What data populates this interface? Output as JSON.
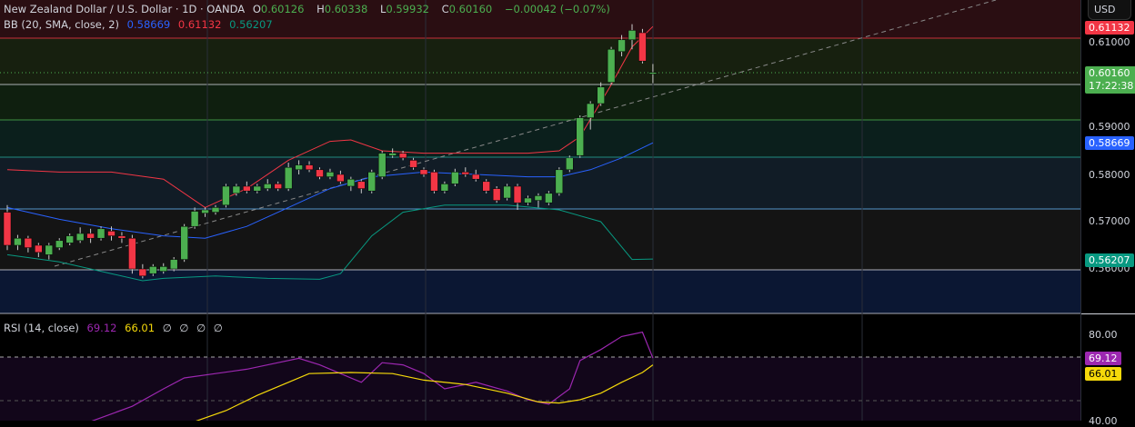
{
  "header": {
    "symbol": "New Zealand Dollar / U.S. Dollar · 1D · OANDA",
    "o_label": "O",
    "o": "0.60126",
    "h_label": "H",
    "h": "0.60338",
    "l_label": "L",
    "l": "0.59932",
    "c_label": "C",
    "c": "0.60160",
    "change": "−0.00042 (−0.07%)"
  },
  "bb": {
    "label": "BB (20, SMA, close, 2)",
    "basis": "0.58669",
    "upper": "0.61132",
    "lower": "0.56207"
  },
  "rsi": {
    "label": "RSI (14, close)",
    "value": "69.12",
    "ma": "66.01",
    "extras": [
      "∅",
      "∅",
      "∅",
      "∅"
    ]
  },
  "axis": {
    "currency": "USD",
    "ticks": [
      "0.59000",
      "0.58000",
      "0.57000"
    ],
    "hidden_ticks": [
      "0.61000",
      "0.56000"
    ],
    "price_tag": "0.60160",
    "countdown": "17:22:38",
    "upper_tag": "0.61132",
    "basis_tag": "0.58669",
    "lower_tag": "0.56207",
    "rsi_ticks": [
      "80.00",
      "40.00"
    ],
    "rsi_tag": "69.12",
    "rsi_ma_tag": "66.01"
  },
  "colors": {
    "up": "#4caf50",
    "down": "#f23645",
    "upper": "#f23645",
    "basis": "#2962ff",
    "lower": "#089981",
    "rsi": "#9c27b0",
    "rsi_ma": "#f5d90a"
  },
  "chart_data": {
    "type": "candlestick",
    "candles": [
      [
        0.572,
        0.5735,
        0.564,
        0.565
      ],
      [
        0.565,
        0.5672,
        0.564,
        0.5665
      ],
      [
        0.5665,
        0.567,
        0.5635,
        0.5645
      ],
      [
        0.565,
        0.5655,
        0.5625,
        0.5635
      ],
      [
        0.563,
        0.5655,
        0.562,
        0.565
      ],
      [
        0.5645,
        0.5665,
        0.564,
        0.566
      ],
      [
        0.5655,
        0.5675,
        0.565,
        0.567
      ],
      [
        0.566,
        0.5688,
        0.5655,
        0.5675
      ],
      [
        0.5675,
        0.5685,
        0.5655,
        0.5665
      ],
      [
        0.5665,
        0.569,
        0.566,
        0.5685
      ],
      [
        0.568,
        0.569,
        0.566,
        0.567
      ],
      [
        0.567,
        0.5678,
        0.5655,
        0.5665
      ],
      [
        0.5665,
        0.5672,
        0.559,
        0.56
      ],
      [
        0.56,
        0.561,
        0.558,
        0.5585
      ],
      [
        0.559,
        0.561,
        0.5585,
        0.5605
      ],
      [
        0.5595,
        0.5612,
        0.559,
        0.5605
      ],
      [
        0.56,
        0.5625,
        0.5595,
        0.562
      ],
      [
        0.562,
        0.5695,
        0.5615,
        0.569
      ],
      [
        0.569,
        0.573,
        0.5685,
        0.5722
      ],
      [
        0.5718,
        0.573,
        0.571,
        0.5725
      ],
      [
        0.572,
        0.5735,
        0.5715,
        0.573
      ],
      [
        0.5735,
        0.578,
        0.573,
        0.5775
      ],
      [
        0.576,
        0.578,
        0.5755,
        0.5775
      ],
      [
        0.5775,
        0.5785,
        0.576,
        0.5765
      ],
      [
        0.5765,
        0.578,
        0.576,
        0.5775
      ],
      [
        0.577,
        0.579,
        0.5765,
        0.578
      ],
      [
        0.578,
        0.5785,
        0.5765,
        0.577
      ],
      [
        0.577,
        0.5825,
        0.5765,
        0.5815
      ],
      [
        0.581,
        0.583,
        0.58,
        0.582
      ],
      [
        0.582,
        0.5828,
        0.5805,
        0.581
      ],
      [
        0.581,
        0.5815,
        0.579,
        0.5795
      ],
      [
        0.5795,
        0.5812,
        0.579,
        0.5805
      ],
      [
        0.58,
        0.5808,
        0.578,
        0.5785
      ],
      [
        0.5775,
        0.5795,
        0.5765,
        0.579
      ],
      [
        0.5785,
        0.579,
        0.576,
        0.577
      ],
      [
        0.5765,
        0.581,
        0.576,
        0.5805
      ],
      [
        0.5795,
        0.585,
        0.579,
        0.5845
      ],
      [
        0.584,
        0.5855,
        0.5835,
        0.5845
      ],
      [
        0.5845,
        0.585,
        0.583,
        0.5835
      ],
      [
        0.583,
        0.5835,
        0.581,
        0.5815
      ],
      [
        0.581,
        0.5815,
        0.5795,
        0.58
      ],
      [
        0.5805,
        0.581,
        0.576,
        0.5765
      ],
      [
        0.5765,
        0.5785,
        0.576,
        0.578
      ],
      [
        0.578,
        0.5812,
        0.5775,
        0.5805
      ],
      [
        0.5805,
        0.5815,
        0.5795,
        0.58
      ],
      [
        0.58,
        0.581,
        0.5785,
        0.579
      ],
      [
        0.5785,
        0.579,
        0.576,
        0.5765
      ],
      [
        0.577,
        0.5775,
        0.574,
        0.5745
      ],
      [
        0.575,
        0.578,
        0.5745,
        0.5775
      ],
      [
        0.5775,
        0.578,
        0.5725,
        0.574
      ],
      [
        0.574,
        0.5755,
        0.5735,
        0.575
      ],
      [
        0.5745,
        0.576,
        0.573,
        0.5755
      ],
      [
        0.574,
        0.5765,
        0.5735,
        0.576
      ],
      [
        0.576,
        0.5815,
        0.5755,
        0.581
      ],
      [
        0.581,
        0.584,
        0.5805,
        0.5835
      ],
      [
        0.584,
        0.5925,
        0.5835,
        0.592
      ],
      [
        0.592,
        0.5955,
        0.5895,
        0.595
      ],
      [
        0.595,
        0.5995,
        0.5945,
        0.5985
      ],
      [
        0.5995,
        0.607,
        0.599,
        0.6065
      ],
      [
        0.606,
        0.6095,
        0.605,
        0.6085
      ],
      [
        0.6085,
        0.6118,
        0.6065,
        0.6105
      ],
      [
        0.61,
        0.6108,
        0.6035,
        0.604
      ],
      [
        0.60126,
        0.60338,
        0.59932,
        0.6016
      ]
    ],
    "bb_upper": [
      [
        0,
        0.581
      ],
      [
        5,
        0.5805
      ],
      [
        10,
        0.5805
      ],
      [
        15,
        0.579
      ],
      [
        19,
        0.573
      ],
      [
        23,
        0.577
      ],
      [
        27,
        0.583
      ],
      [
        31,
        0.587
      ],
      [
        33,
        0.5873
      ],
      [
        36,
        0.585
      ],
      [
        40,
        0.5845
      ],
      [
        45,
        0.5845
      ],
      [
        50,
        0.5845
      ],
      [
        53,
        0.585
      ],
      [
        55,
        0.588
      ],
      [
        58,
        0.599
      ],
      [
        60,
        0.607
      ],
      [
        62,
        0.6113
      ]
    ],
    "bb_basis": [
      [
        0,
        0.573
      ],
      [
        5,
        0.5705
      ],
      [
        10,
        0.5685
      ],
      [
        15,
        0.567
      ],
      [
        19,
        0.5665
      ],
      [
        23,
        0.569
      ],
      [
        27,
        0.573
      ],
      [
        31,
        0.577
      ],
      [
        35,
        0.5795
      ],
      [
        40,
        0.5805
      ],
      [
        45,
        0.58
      ],
      [
        50,
        0.5795
      ],
      [
        53,
        0.5795
      ],
      [
        56,
        0.581
      ],
      [
        59,
        0.5835
      ],
      [
        62,
        0.5867
      ]
    ],
    "bb_lower": [
      [
        0,
        0.563
      ],
      [
        5,
        0.5615
      ],
      [
        10,
        0.559
      ],
      [
        13,
        0.5575
      ],
      [
        15,
        0.558
      ],
      [
        20,
        0.5585
      ],
      [
        25,
        0.558
      ],
      [
        30,
        0.5578
      ],
      [
        32,
        0.559
      ],
      [
        35,
        0.567
      ],
      [
        38,
        0.572
      ],
      [
        42,
        0.5735
      ],
      [
        48,
        0.5735
      ],
      [
        53,
        0.5725
      ],
      [
        57,
        0.57
      ],
      [
        60,
        0.562
      ],
      [
        62,
        0.5621
      ]
    ],
    "rsi_line": [
      [
        8,
        40
      ],
      [
        12,
        47
      ],
      [
        15,
        55
      ],
      [
        17,
        60
      ],
      [
        20,
        62
      ],
      [
        23,
        64
      ],
      [
        26,
        67
      ],
      [
        28,
        69
      ],
      [
        30,
        66
      ],
      [
        32,
        62
      ],
      [
        34,
        58
      ],
      [
        36,
        67
      ],
      [
        38,
        66
      ],
      [
        40,
        62
      ],
      [
        42,
        55
      ],
      [
        45,
        58
      ],
      [
        48,
        54
      ],
      [
        50,
        50
      ],
      [
        52,
        48
      ],
      [
        54,
        55
      ],
      [
        55,
        68
      ],
      [
        57,
        73
      ],
      [
        59,
        79
      ],
      [
        60,
        80
      ],
      [
        61,
        81
      ],
      [
        62,
        69.12
      ]
    ],
    "rsi_ma": [
      [
        18,
        40
      ],
      [
        21,
        45
      ],
      [
        24,
        52
      ],
      [
        27,
        58
      ],
      [
        29,
        62
      ],
      [
        33,
        62.5
      ],
      [
        37,
        62
      ],
      [
        40,
        59
      ],
      [
        44,
        57
      ],
      [
        48,
        53
      ],
      [
        51,
        49
      ],
      [
        53,
        48.5
      ],
      [
        55,
        50
      ],
      [
        57,
        53
      ],
      [
        59,
        58
      ],
      [
        61,
        62.5
      ],
      [
        62,
        66.01
      ]
    ],
    "price_range": [
      0.552,
      0.619
    ],
    "rsi_range": [
      40,
      87.5
    ]
  }
}
